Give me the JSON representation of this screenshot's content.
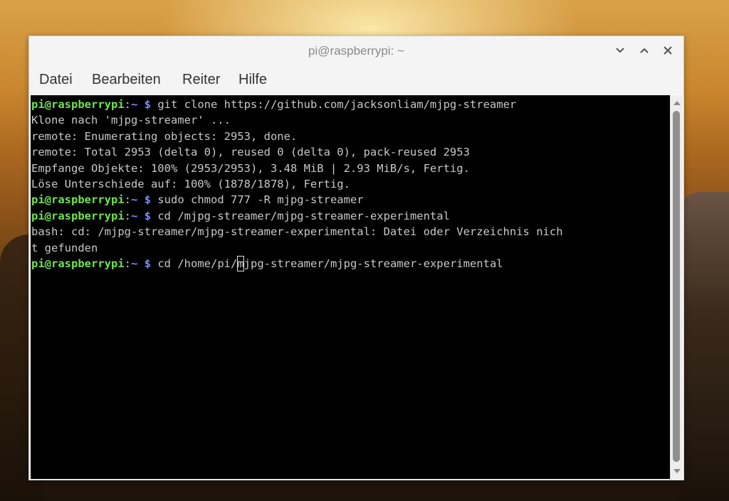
{
  "window": {
    "title": "pi@raspberrypi: ~",
    "controls": [
      "minimize",
      "maximize",
      "close"
    ]
  },
  "menu": {
    "items": [
      "Datei",
      "Bearbeiten",
      "Reiter",
      "Hilfe"
    ]
  },
  "prompt": {
    "user": "pi@raspberrypi",
    "sep": ":",
    "path": "~ $"
  },
  "terminal": {
    "lines": [
      {
        "type": "cmd",
        "text": " git clone https://github.com/jacksonliam/mjpg-streamer"
      },
      {
        "type": "out",
        "text": "Klone nach 'mjpg-streamer' ..."
      },
      {
        "type": "out",
        "text": "remote: Enumerating objects: 2953, done."
      },
      {
        "type": "out",
        "text": "remote: Total 2953 (delta 0), reused 0 (delta 0), pack-reused 2953"
      },
      {
        "type": "out",
        "text": "Empfange Objekte: 100% (2953/2953), 3.48 MiB | 2.93 MiB/s, Fertig."
      },
      {
        "type": "out",
        "text": "Löse Unterschiede auf: 100% (1878/1878), Fertig."
      },
      {
        "type": "cmd",
        "text": " sudo chmod 777 -R mjpg-streamer"
      },
      {
        "type": "cmd",
        "text": " cd /mjpg-streamer/mjpg-streamer-experimental"
      },
      {
        "type": "out",
        "text": "bash: cd: /mjpg-streamer/mjpg-streamer-experimental: Datei oder Verzeichnis nich"
      },
      {
        "type": "out",
        "text": "t gefunden"
      }
    ],
    "current": {
      "before": " cd /home/pi/",
      "cursor": "m",
      "after": "jpg-streamer/mjpg-streamer-experimental"
    }
  },
  "colors": {
    "prompt_user": "#6fe54b",
    "prompt_path": "#7b8cff",
    "terminal_bg": "#000000",
    "terminal_fg": "#c8c8c8"
  }
}
